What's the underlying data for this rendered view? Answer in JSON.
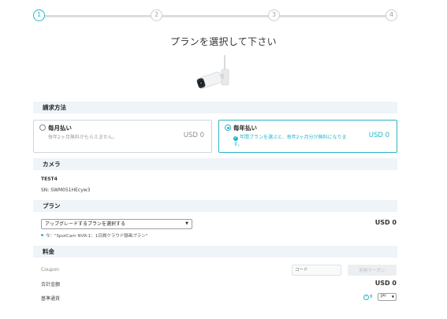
{
  "stepper": {
    "steps": [
      "1",
      "2",
      "3",
      "4"
    ],
    "active_step": 1
  },
  "page_title": "プランを選択して下さい",
  "colors": {
    "accent": "#29b6c6",
    "section_bg": "#eef4f8",
    "muted": "#9aa0a6"
  },
  "billing": {
    "heading": "請求方法",
    "monthly": {
      "title": "毎月払い",
      "desc": "毎年2ヶ月無料がもらえません。",
      "price": "USD 0",
      "selected": false
    },
    "yearly": {
      "title": "毎年払い",
      "desc": "年間プランを選ぶと、毎年2ヶ月分が無料になります。",
      "price": "USD 0",
      "selected": true
    }
  },
  "camera": {
    "heading": "カメラ",
    "name": "TEST4",
    "serial": "SN: SWM051HEcyw3"
  },
  "plan": {
    "heading": "プラン",
    "select_value": "アップグレードするプランを選択する",
    "price": "USD  0",
    "current_note": "今：\"SpotCam NVR-1：1日間クラウド録画プラン\""
  },
  "pricing": {
    "heading": "料金",
    "coupon_label": "Coupon",
    "coupon_placeholder": "コード",
    "coupon_button": "利用クーポン",
    "total_label": "合計金額",
    "total_value": "USD 0",
    "base_currency_label": "基準通貨",
    "help_icon_text": "?",
    "help_count": "0",
    "currency_value": "JPY"
  }
}
